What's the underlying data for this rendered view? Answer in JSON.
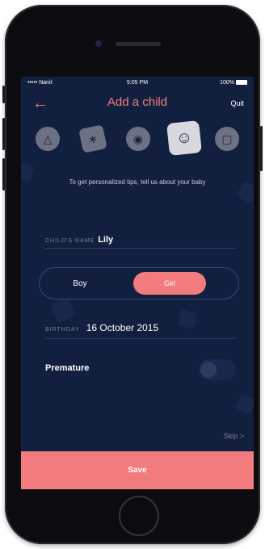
{
  "status_bar": {
    "carrier": "••••• Nanit ",
    "time": "5:05 PM",
    "battery": "100%"
  },
  "header": {
    "title": "Add a child",
    "quit_label": "Quit"
  },
  "avatars": [
    {
      "icon": "rocket-icon"
    },
    {
      "icon": "bluetooth-icon"
    },
    {
      "icon": "camera-icon"
    },
    {
      "icon": "smiley-face-icon",
      "selected": true
    },
    {
      "icon": "square-icon"
    }
  ],
  "tagline": "To get personalized tips, tell us about your baby",
  "name_field": {
    "label": "CHILD'S NAME",
    "value": "Lily"
  },
  "gender": {
    "options": [
      "Boy",
      "Girl"
    ],
    "selected": "Girl"
  },
  "birthday_field": {
    "label": "BIRTHDAY",
    "value": "16 October 2015"
  },
  "premature": {
    "label": "Premature",
    "on": false
  },
  "skip_label": "Skip >",
  "save_label": "Save",
  "colors": {
    "accent": "#f27b7d",
    "background": "#12203f"
  }
}
